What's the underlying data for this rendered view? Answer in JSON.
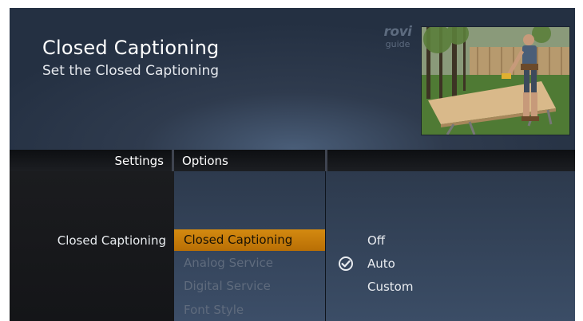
{
  "header": {
    "title": "Closed Captioning",
    "subtitle": "Set the Closed Captioning"
  },
  "logo": {
    "main": "rovi",
    "sub": "guide"
  },
  "columns": {
    "settings_header": "Settings",
    "options_header": "Options"
  },
  "settings": {
    "items": [
      "Closed Captioning"
    ]
  },
  "options": {
    "items": [
      "Closed Captioning",
      "Analog Service",
      "Digital Service",
      "Font Style"
    ],
    "selected_index": 0
  },
  "values": {
    "items": [
      "Off",
      "Auto",
      "Custom"
    ],
    "checked": "Auto"
  },
  "colors": {
    "highlight": "#c98008",
    "background": "#2f3b4e"
  }
}
